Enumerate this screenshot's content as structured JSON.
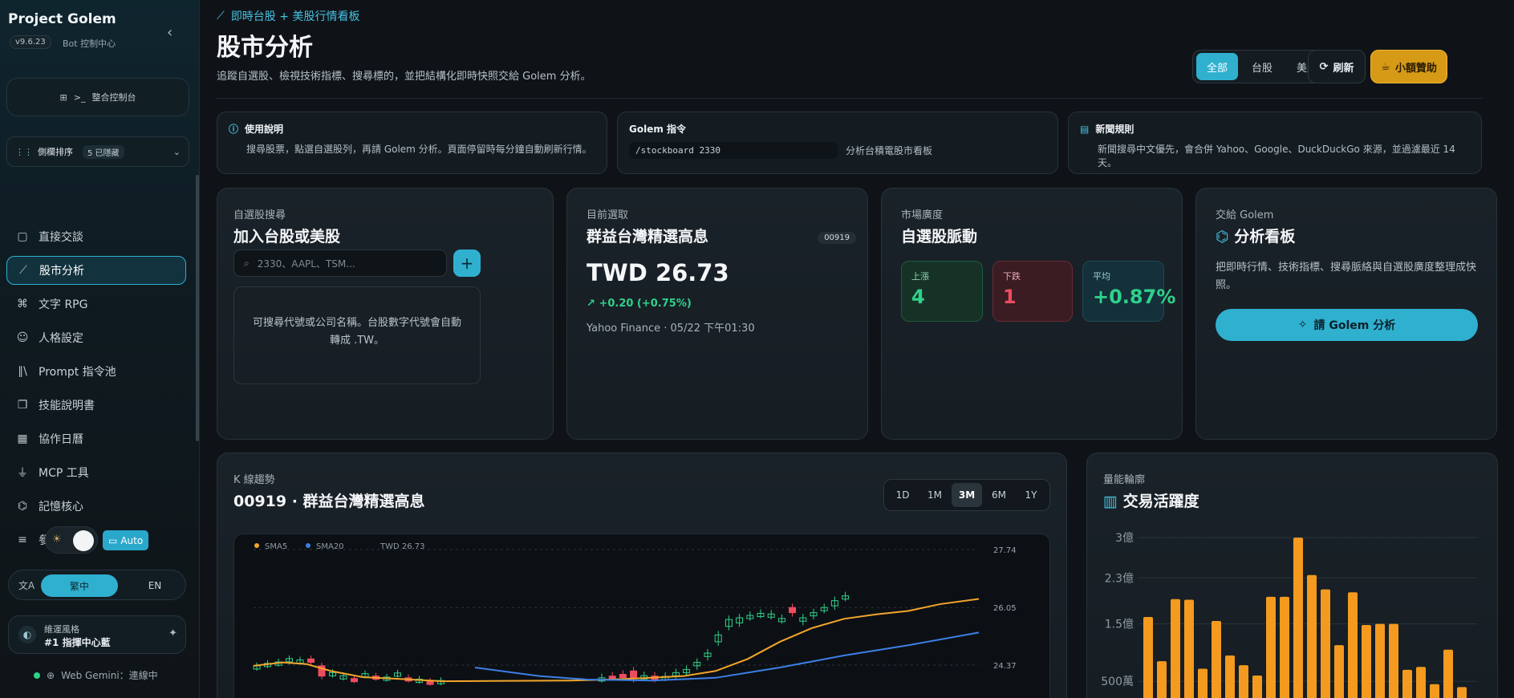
{
  "app": {
    "name": "Project Golem",
    "version": "v9.6.23",
    "subtitle": "Bot 控制中心"
  },
  "sidebar": {
    "console_label": "整合控制台",
    "sort_label": "側欄排序",
    "sort_badge": "5 已隱藏",
    "items": [
      {
        "label": "直接交談",
        "icon": "chat-icon"
      },
      {
        "label": "股市分析",
        "icon": "chart-line-icon",
        "active": true
      },
      {
        "label": "文字 RPG",
        "icon": "gamepad-icon"
      },
      {
        "label": "人格設定",
        "icon": "user-icon"
      },
      {
        "label": "Prompt 指令池",
        "icon": "library-icon"
      },
      {
        "label": "技能說明書",
        "icon": "book-icon"
      },
      {
        "label": "協作日曆",
        "icon": "calendar-icon"
      },
      {
        "label": "MCP 工具",
        "icon": "plug-icon"
      },
      {
        "label": "記憶核心",
        "icon": "brain-icon"
      },
      {
        "label": "參考文件",
        "icon": "database-icon"
      }
    ],
    "theme_auto": "Auto",
    "lang_zh": "繁中",
    "lang_en": "EN",
    "style_label": "維運風格",
    "style_value": "#1 指揮中心藍",
    "connection": "Web Gemini：連線中"
  },
  "header": {
    "kicker": "即時台股 + 美股行情看板",
    "title": "股市分析",
    "desc": "追蹤自選股、檢視技術指標、搜尋標的，並把結構化即時快照交給 Golem 分析。",
    "markets": [
      "全部",
      "台股",
      "美股"
    ],
    "refresh": "刷新",
    "sponsor": "小額贊助"
  },
  "info": {
    "usage_title": "使用說明",
    "usage_text": "搜尋股票，點選自選股列，再請 Golem 分析。頁面停留時每分鐘自動刷新行情。",
    "cmd_title": "Golem 指令",
    "cmd_code": "/stockboard 2330",
    "cmd_text": "分析台積電股市看板",
    "news_title": "新聞規則",
    "news_text": "新聞搜尋中文優先，會合併 Yahoo、Google、DuckDuckGo 來源，並過濾最近 14 天。"
  },
  "search_card": {
    "label": "自選股搜尋",
    "title": "加入台股或美股",
    "placeholder": "2330、AAPL、TSM...",
    "hint": "可搜尋代號或公司名稱。台股數字代號會自動轉成 .TW。"
  },
  "current": {
    "label": "目前選取",
    "name": "群益台灣精選高息",
    "code": "00919",
    "price": "TWD 26.73",
    "change": "+0.20 (+0.75%)",
    "source": "Yahoo Finance · 05/22 下午01:30"
  },
  "breadth": {
    "label": "市場廣度",
    "title": "自選股脈動",
    "up_label": "上漲",
    "up": "4",
    "down_label": "下跌",
    "down": "1",
    "avg_label": "平均",
    "avg": "+0.87%"
  },
  "golem": {
    "label": "交給 Golem",
    "title": "分析看板",
    "desc": "把即時行情、技術指標、搜尋脈絡與自選股廣度整理成快照。",
    "button": "請 Golem 分析"
  },
  "kline": {
    "label": "K 線趨勢",
    "title": "00919 · 群益台灣精選高息",
    "ranges": [
      "1D",
      "1M",
      "3M",
      "6M",
      "1Y"
    ],
    "active_range": "3M",
    "legend": [
      "SMA5",
      "SMA20",
      "TWD 26.73"
    ],
    "yticks": [
      "27.74",
      "26.05",
      "24.37"
    ]
  },
  "volume": {
    "label": "量能輪廓",
    "title": "交易活躍度",
    "yticks": [
      "3億",
      "2.3億",
      "1.5億",
      "500萬"
    ]
  },
  "colors": {
    "accent": "#2fb0cf",
    "up": "#2fd18a",
    "down": "#ef4c5e",
    "sma5": "#f3a52b",
    "sma20": "#3d7fe6",
    "volume": "#f39a1f"
  },
  "chart_data": [
    {
      "type": "line",
      "title": "00919 · 群益台灣精選高息",
      "series": [
        {
          "name": "SMA5"
        },
        {
          "name": "SMA20"
        }
      ],
      "ylim": [
        24.37,
        27.74
      ],
      "last_price": 26.73
    },
    {
      "type": "bar",
      "title": "交易活躍度",
      "values": [
        1.62,
        0.85,
        1.93,
        1.92,
        0.72,
        1.55,
        0.95,
        0.78,
        0.6,
        1.97,
        1.97,
        3,
        2.35,
        2.1,
        1.13,
        2.05,
        1.48,
        1.5,
        1.5,
        0.7,
        0.75,
        0.45,
        1.05,
        0.4
      ],
      "ylim": [
        0,
        3.1
      ]
    }
  ]
}
